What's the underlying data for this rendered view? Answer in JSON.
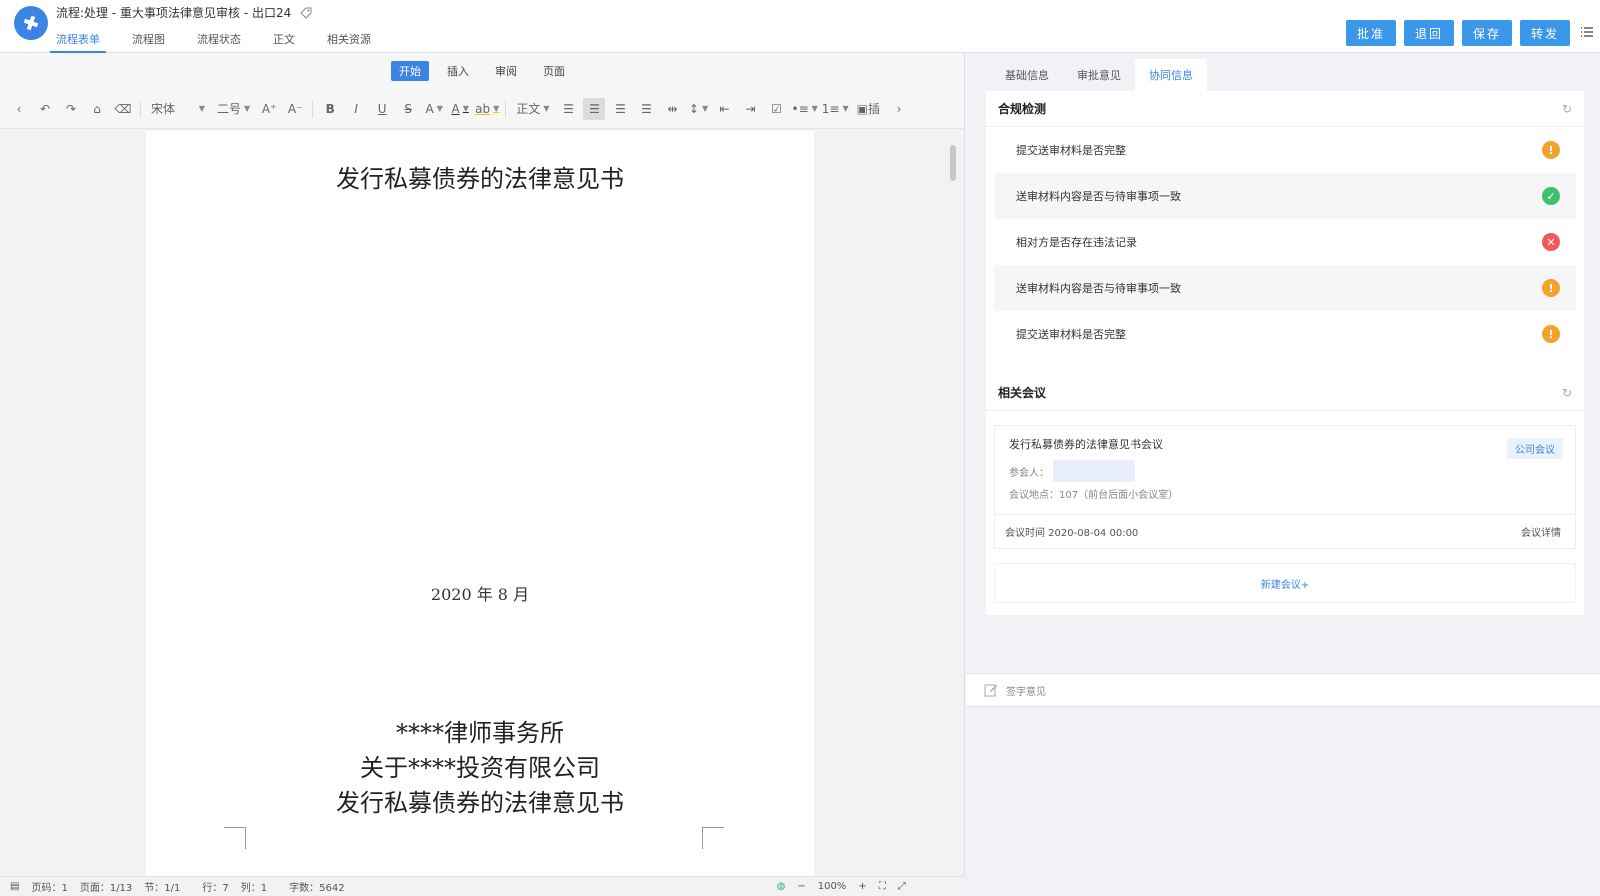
{
  "header": {
    "title": "流程:处理 - 重大事项法律意见审核 - 出口24",
    "tabs": [
      "流程表单",
      "流程图",
      "流程状态",
      "正文",
      "相关资源"
    ],
    "actions": [
      "批准",
      "退回",
      "保存",
      "转发"
    ],
    "accent": "#3b84e6"
  },
  "editor": {
    "ribbon_tabs": [
      "开始",
      "插入",
      "审阅",
      "页面"
    ],
    "toolbar": {
      "font": "宋体",
      "size": "二号",
      "style": "正文",
      "insert": "插"
    },
    "document": {
      "title": "发行私募债券的法律意见书",
      "date": "2020 年 8 月",
      "line1": "****律师事务所",
      "line2": "关于****投资有限公司",
      "line3": "发行私募债券的法律意见书"
    },
    "status": {
      "page_no": "页码：1",
      "pages": "页面：1/13",
      "section": "节：1/1",
      "row": "行：7",
      "col": "列：1",
      "words": "字数：5642",
      "zoom": "100%"
    }
  },
  "panel": {
    "tabs": [
      "基础信息",
      "审批意见",
      "协同信息"
    ],
    "compliance": {
      "title": "合规检测",
      "items": [
        {
          "label": "提交送审材料是否完整",
          "status": "warn",
          "glyph": "!"
        },
        {
          "label": "送审材料内容是否与待审事项一致",
          "status": "ok",
          "glyph": "✓"
        },
        {
          "label": "相对方是否存在违法记录",
          "status": "err",
          "glyph": "✕"
        },
        {
          "label": "送审材料内容是否与待审事项一致",
          "status": "warn",
          "glyph": "!"
        },
        {
          "label": "提交送审材料是否完整",
          "status": "warn",
          "glyph": "!"
        }
      ]
    },
    "meeting": {
      "title": "相关会议",
      "name": "发行私募债券的法律意见书会议",
      "participants_label": "参会人：",
      "location": "会议地点：107（前台后面小会议室）",
      "tag": "公司会议",
      "time": "会议时间 2020-08-04 00:00",
      "detail": "会议详情",
      "new": "新建会议+"
    },
    "sign": "签字意见"
  }
}
